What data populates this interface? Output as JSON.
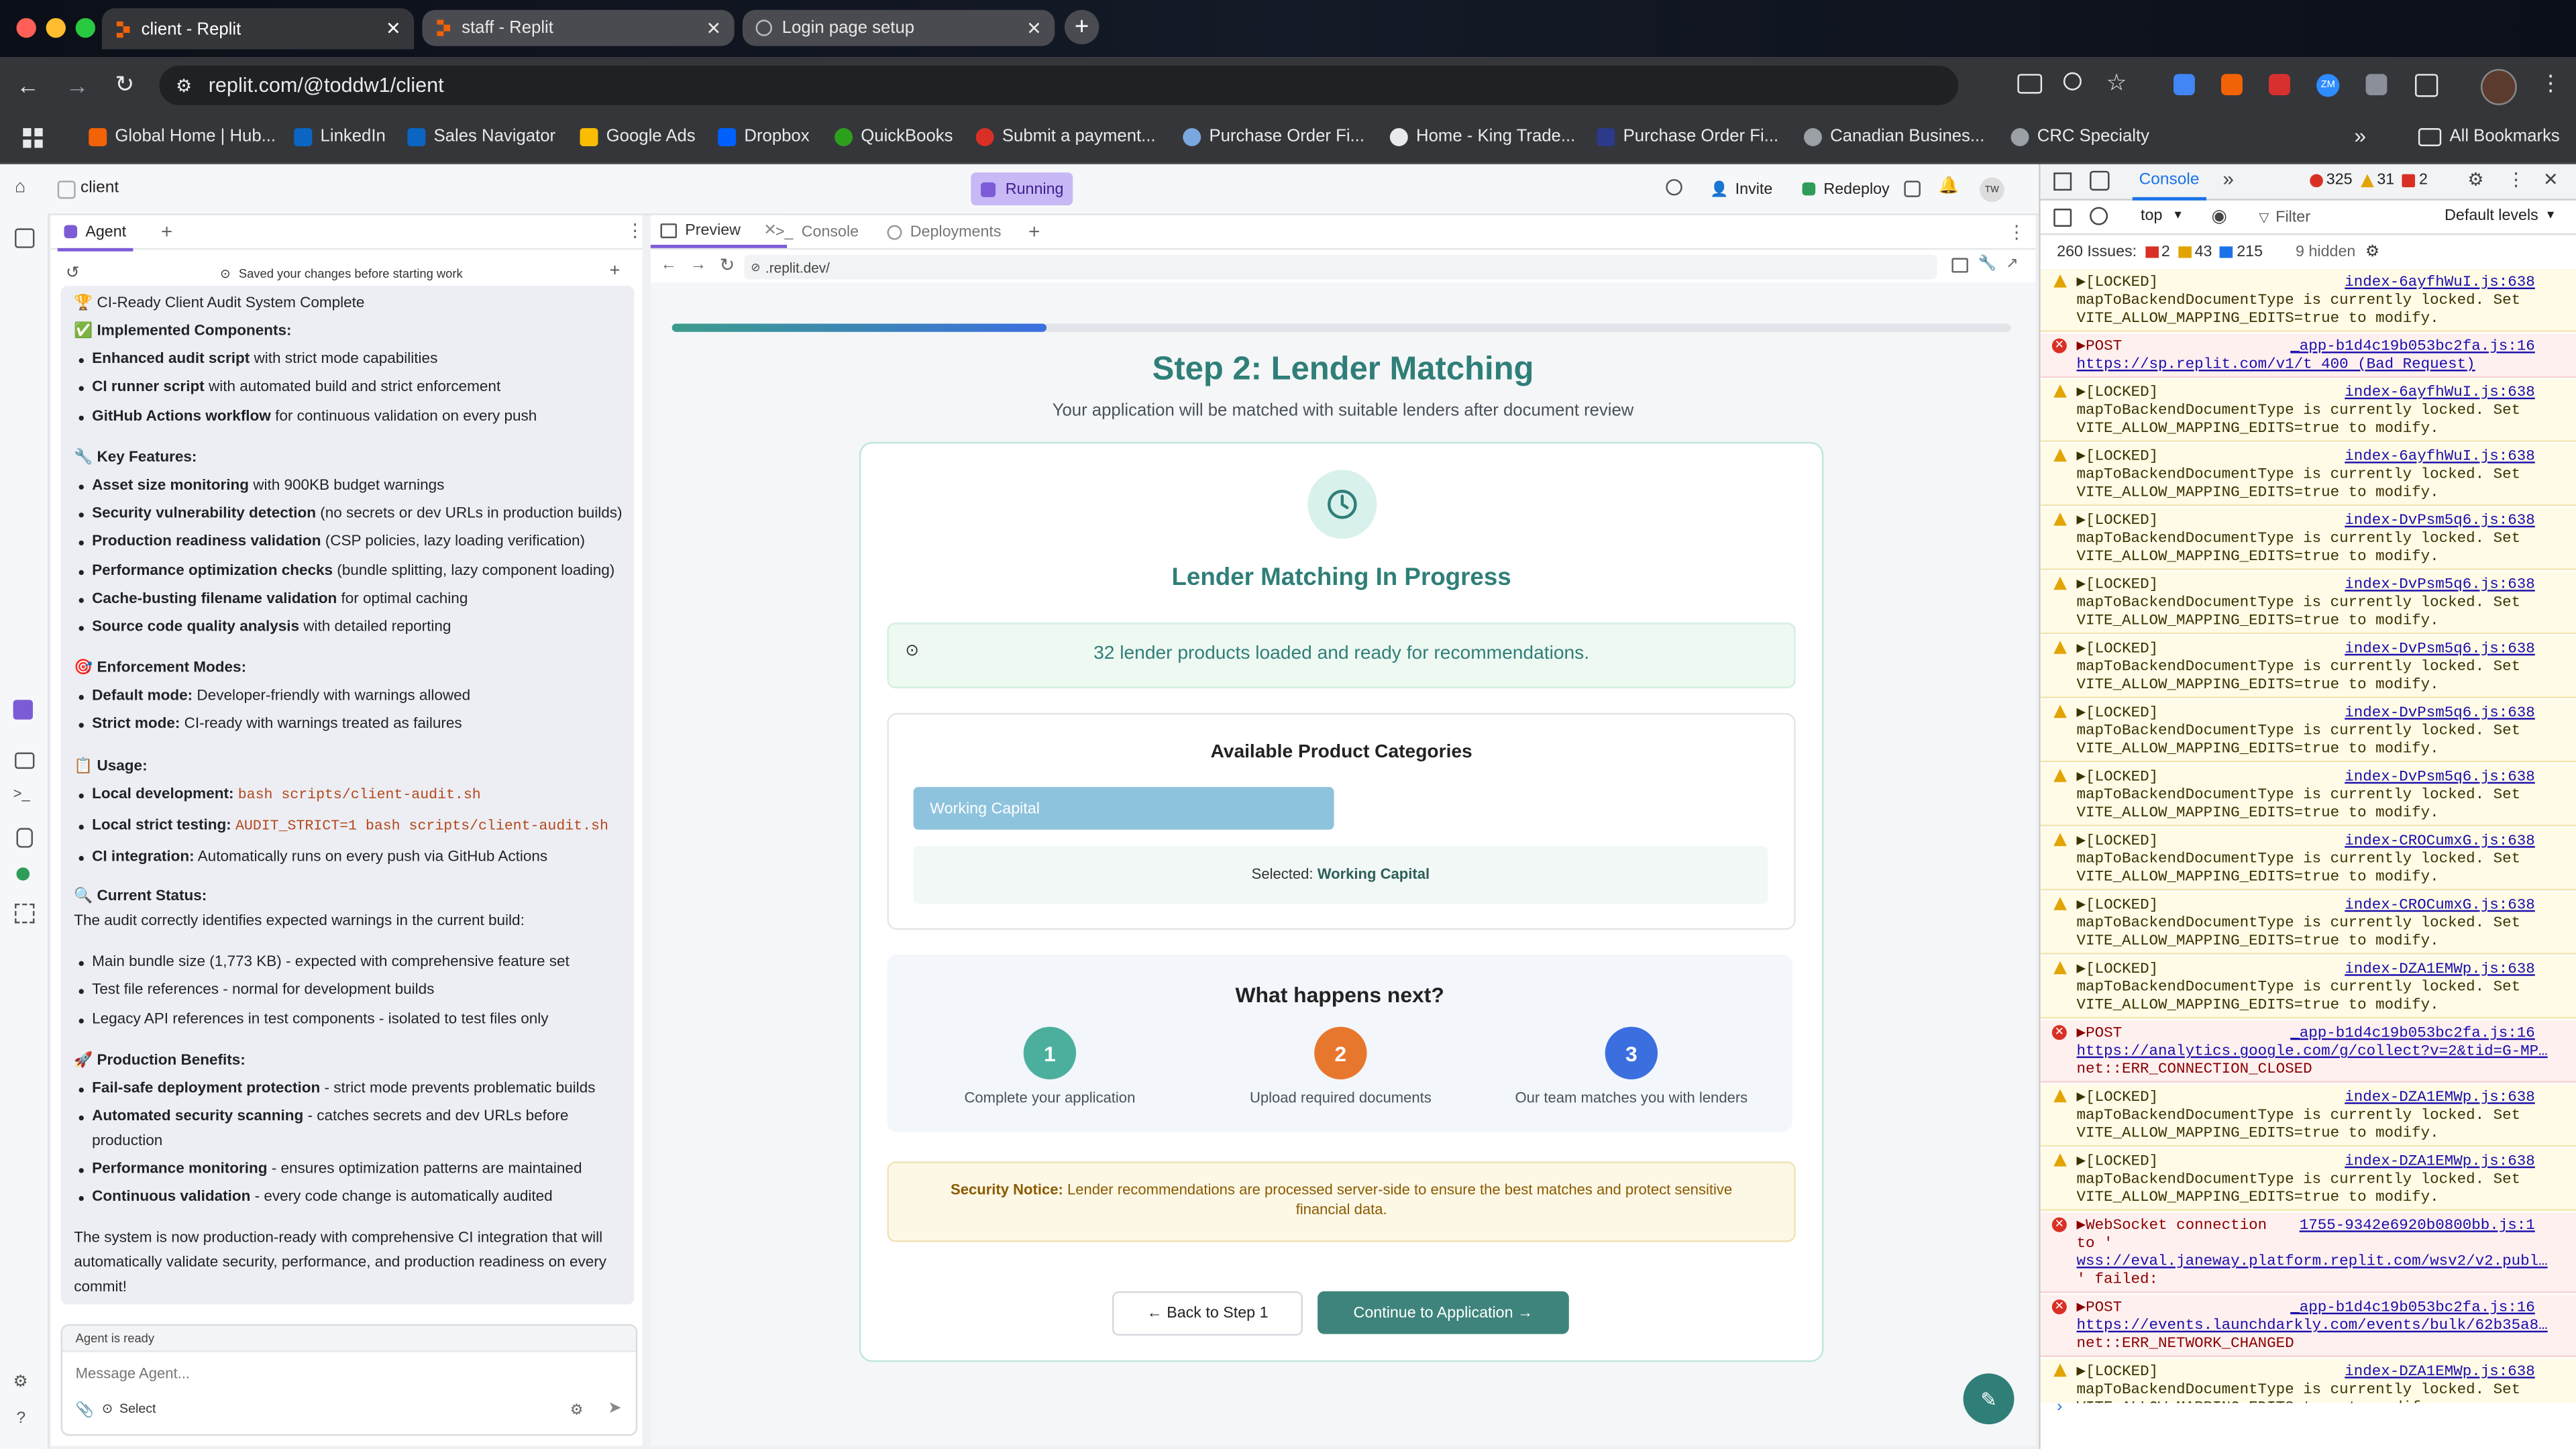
{
  "browser": {
    "tabs": [
      {
        "title": "client - Replit"
      },
      {
        "title": "staff - Replit"
      },
      {
        "title": "Login page setup"
      }
    ],
    "url": "replit.com/@toddw1/client",
    "bookmarks": [
      "Global Home | Hub...",
      "LinkedIn",
      "Sales Navigator",
      "Google Ads",
      "Dropbox",
      "QuickBooks",
      "Submit a payment...",
      "Purchase Order Fi...",
      "Home - King Trade...",
      "Purchase Order Fi...",
      "Canadian Busines...",
      "CRC Specialty"
    ],
    "all_bookmarks": "All Bookmarks",
    "avatar_initials": "ZM"
  },
  "workspace": {
    "repl_name": "client",
    "status": "Running",
    "invite": "Invite",
    "redeploy": "Redeploy",
    "user_initials": "TW"
  },
  "agent": {
    "tab": "Agent",
    "saved_notice": "Saved your changes before starting work",
    "heading": "CI-Ready Client Audit System Complete",
    "implemented": "Implemented Components:",
    "components": [
      {
        "b": "Enhanced audit script",
        "t": " with strict mode capabilities"
      },
      {
        "b": "CI runner script",
        "t": " with automated build and strict enforcement"
      },
      {
        "b": "GitHub Actions workflow",
        "t": " for continuous validation on every push"
      }
    ],
    "key_features": "Key Features:",
    "features": [
      {
        "b": "Asset size monitoring",
        "t": " with 900KB budget warnings"
      },
      {
        "b": "Security vulnerability detection",
        "t": " (no secrets or dev URLs in production builds)"
      },
      {
        "b": "Production readiness validation",
        "t": " (CSP policies, lazy loading verification)"
      },
      {
        "b": "Performance optimization checks",
        "t": " (bundle splitting, lazy component loading)"
      },
      {
        "b": "Cache-busting filename validation",
        "t": " for optimal caching"
      },
      {
        "b": "Source code quality analysis",
        "t": " with detailed reporting"
      }
    ],
    "enforcement": "Enforcement Modes:",
    "modes": [
      {
        "b": "Default mode:",
        "t": " Developer-friendly with warnings allowed"
      },
      {
        "b": "Strict mode:",
        "t": " CI-ready with warnings treated as failures"
      }
    ],
    "usage": "Usage:",
    "usage_items": [
      {
        "b": "Local development:",
        "c": "bash scripts/client-audit.sh",
        "t": ""
      },
      {
        "b": "Local strict testing:",
        "c": "AUDIT_STRICT=1 bash scripts/client-audit.sh",
        "t": ""
      },
      {
        "b": "CI integration:",
        "c": "",
        "t": " Automatically runs on every push via GitHub Actions"
      }
    ],
    "current_status": "Current Status:",
    "status_intro": "The audit correctly identifies expected warnings in the current build:",
    "status_items": [
      "Main bundle size (1,773 KB) - expected with comprehensive feature set",
      "Test file references - normal for development builds",
      "Legacy API references in test components - isolated to test files only"
    ],
    "benefits": "Production Benefits:",
    "benefit_items": [
      {
        "b": "Fail-safe deployment protection",
        "t": " - strict mode prevents problematic builds"
      },
      {
        "b": "Automated security scanning",
        "t": " - catches secrets and dev URLs before"
      },
      {
        "b": "",
        "t": "production"
      },
      {
        "b": "Performance monitoring",
        "t": " - ensures optimization patterns are maintained"
      },
      {
        "b": "Continuous validation",
        "t": " - every code change is automatically audited"
      }
    ],
    "summary": [
      "The system is now production-ready with comprehensive CI integration that will",
      "automatically validate security, performance, and production readiness on every",
      "commit!"
    ],
    "agent_status": "Agent is ready",
    "input_placeholder": "Message Agent...",
    "select_label": "Select"
  },
  "preview": {
    "tabs": [
      "Preview",
      "Console",
      "Deployments"
    ],
    "url": ".replit.dev/",
    "progress": 0.28,
    "title": "Step 2: Lender Matching",
    "subtitle": "Your application will be matched with suitable lenders after document review",
    "in_progress": "Lender Matching In Progress",
    "loaded_msg": "32 lender products loaded and ready for recommendations.",
    "categories_title": "Available Product Categories",
    "category": "Working Capital",
    "selected_label": "Selected:",
    "selected_value": "Working Capital",
    "next_title": "What happens next?",
    "steps": [
      {
        "num": "1",
        "label": "Complete your application",
        "color": "#4caf9e"
      },
      {
        "num": "2",
        "label": "Upload required documents",
        "color": "#e8772e"
      },
      {
        "num": "3",
        "label": "Our team matches you with lenders",
        "color": "#3b6fe0"
      }
    ],
    "security_label": "Security Notice:",
    "security_text_1": "Lender recommendations are processed server-side to ensure the best matches and protect sensitive",
    "security_text_2": "financial data.",
    "back_btn": "← Back to Step 1",
    "continue_btn": "Continue to Application →",
    "accent": "#2f7f78"
  },
  "devtools": {
    "tab": "Console",
    "errors": "325",
    "warnings": "31",
    "info": "2",
    "context": "top",
    "filter_placeholder": "Filter",
    "levels": "Default levels",
    "issues_label": "260 Issues:",
    "issues_err": "2",
    "issues_warn": "43",
    "issues_info": "215",
    "hidden": "9 hidden",
    "rows": [
      {
        "type": "warn",
        "t": "▶[LOCKED]",
        "src": "index-6ayfhWuI.js:638",
        "l2": "mapToBackendDocumentType is currently locked. Set",
        "l3": "VITE_ALLOW_MAPPING_EDITS=true to modify."
      },
      {
        "type": "err",
        "t": "▶POST",
        "src": "_app-b1d4c19b053bc2fa.js:16",
        "l2": "https://sp.replit.com/v1/t 400 (Bad Request)",
        "l3": ""
      },
      {
        "type": "warn",
        "t": "▶[LOCKED]",
        "src": "index-6ayfhWuI.js:638",
        "l2": "mapToBackendDocumentType is currently locked. Set",
        "l3": "VITE_ALLOW_MAPPING_EDITS=true to modify."
      },
      {
        "type": "warn",
        "t": "▶[LOCKED]",
        "src": "index-6ayfhWuI.js:638",
        "l2": "mapToBackendDocumentType is currently locked. Set",
        "l3": "VITE_ALLOW_MAPPING_EDITS=true to modify."
      },
      {
        "type": "warn",
        "t": "▶[LOCKED]",
        "src": "index-DvPsm5q6.js:638",
        "l2": "mapToBackendDocumentType is currently locked. Set",
        "l3": "VITE_ALLOW_MAPPING_EDITS=true to modify."
      },
      {
        "type": "warn",
        "t": "▶[LOCKED]",
        "src": "index-DvPsm5q6.js:638",
        "l2": "mapToBackendDocumentType is currently locked. Set",
        "l3": "VITE_ALLOW_MAPPING_EDITS=true to modify."
      },
      {
        "type": "warn",
        "t": "▶[LOCKED]",
        "src": "index-DvPsm5q6.js:638",
        "l2": "mapToBackendDocumentType is currently locked. Set",
        "l3": "VITE_ALLOW_MAPPING_EDITS=true to modify."
      },
      {
        "type": "warn",
        "t": "▶[LOCKED]",
        "src": "index-DvPsm5q6.js:638",
        "l2": "mapToBackendDocumentType is currently locked. Set",
        "l3": "VITE_ALLOW_MAPPING_EDITS=true to modify."
      },
      {
        "type": "warn",
        "t": "▶[LOCKED]",
        "src": "index-DvPsm5q6.js:638",
        "l2": "mapToBackendDocumentType is currently locked. Set",
        "l3": "VITE_ALLOW_MAPPING_EDITS=true to modify."
      },
      {
        "type": "warn",
        "t": "▶[LOCKED]",
        "src": "index-CROCumxG.js:638",
        "l2": "mapToBackendDocumentType is currently locked. Set",
        "l3": "VITE_ALLOW_MAPPING_EDITS=true to modify."
      },
      {
        "type": "warn",
        "t": "▶[LOCKED]",
        "src": "index-CROCumxG.js:638",
        "l2": "mapToBackendDocumentType is currently locked. Set",
        "l3": "VITE_ALLOW_MAPPING_EDITS=true to modify."
      },
      {
        "type": "warn",
        "t": "▶[LOCKED]",
        "src": "index-DZA1EMWp.js:638",
        "l2": "mapToBackendDocumentType is currently locked. Set",
        "l3": "VITE_ALLOW_MAPPING_EDITS=true to modify."
      },
      {
        "type": "err",
        "t": "▶POST",
        "src": "_app-b1d4c19b053bc2fa.js:16",
        "l2": "https://analytics.google.com/g/collect?v=2&tid=G-MP…",
        "l3": "net::ERR_CONNECTION_CLOSED"
      },
      {
        "type": "warn",
        "t": "▶[LOCKED]",
        "src": "index-DZA1EMWp.js:638",
        "l2": "mapToBackendDocumentType is currently locked. Set",
        "l3": "VITE_ALLOW_MAPPING_EDITS=true to modify."
      },
      {
        "type": "warn",
        "t": "▶[LOCKED]",
        "src": "index-DZA1EMWp.js:638",
        "l2": "mapToBackendDocumentType is currently locked. Set",
        "l3": "VITE_ALLOW_MAPPING_EDITS=true to modify."
      },
      {
        "type": "err",
        "t": "▶WebSocket connection",
        "src": "1755-9342e6920b0800bb.js:1",
        "l2": "to '",
        "l3": "wss://eval.janeway.platform.replit.com/wsv2/v2.publ…",
        "l4": "' failed:"
      },
      {
        "type": "err",
        "t": "▶POST",
        "src": "_app-b1d4c19b053bc2fa.js:16",
        "l2": "https://events.launchdarkly.com/events/bulk/62b35a8…",
        "l3": "net::ERR_NETWORK_CHANGED"
      },
      {
        "type": "warn",
        "t": "▶[LOCKED]",
        "src": "index-DZA1EMWp.js:638",
        "l2": "mapToBackendDocumentType is currently locked. Set",
        "l3": "VITE_ALLOW_MAPPING_EDITS=true to modify."
      }
    ]
  }
}
